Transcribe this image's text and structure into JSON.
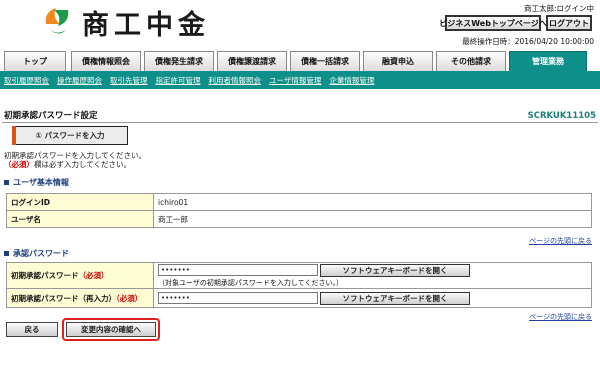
{
  "header": {
    "logo_text": "商工中金",
    "user_line": "商工太郎:ログイン中",
    "top_page_button": "ビジネスWebトップページへ",
    "logout_button": "ログアウト",
    "last_operation": "最終操作日時：2016/04/20 10:00:00"
  },
  "tabs": [
    "トップ",
    "債権情報照会",
    "債権発生請求",
    "債権譲渡請求",
    "債権一括請求",
    "融資申込",
    "その他請求",
    "管理業務"
  ],
  "subnav": [
    "取引履歴照会",
    "操作履歴照会",
    "取引先管理",
    "指定許可管理",
    "利用者情報照会",
    "ユーザ情報管理",
    "企業情報管理"
  ],
  "page": {
    "title": "初期承認パスワード設定",
    "code": "SCRKUK11105",
    "step_label": "① パスワードを入力",
    "instruction_1": "初期承認パスワードを入力してください。",
    "required_mark": "（必須）",
    "instruction_2": "欄は必ず入力してください。"
  },
  "user_info": {
    "heading": "ユーザ基本情報",
    "rows": [
      {
        "label": "ログインID",
        "value": "ichiro01"
      },
      {
        "label": "ユーザ名",
        "value": "商工一郎"
      }
    ],
    "top_link": "ページの先頭に戻る"
  },
  "approval": {
    "heading": "承認パスワード",
    "row1_label": "初期承認パスワード",
    "row1_req": "（必須）",
    "row1_value": "•••••••",
    "row1_kbd": "ソフトウェアキーボードを開く",
    "row1_note": "（対象ユーザの初期承認パスワードを入力してください。）",
    "row2_label": "初期承認パスワード（再入力）",
    "row2_req": "（必須）",
    "row2_value": "•••••••",
    "row2_kbd": "ソフトウェアキーボードを開く",
    "top_link": "ページの先頭に戻る"
  },
  "buttons": {
    "back": "戻る",
    "confirm": "変更内容の確認へ"
  },
  "colors": {
    "accent": "#0e8f8a",
    "required": "#cc0000",
    "highlight": "#e02020"
  }
}
